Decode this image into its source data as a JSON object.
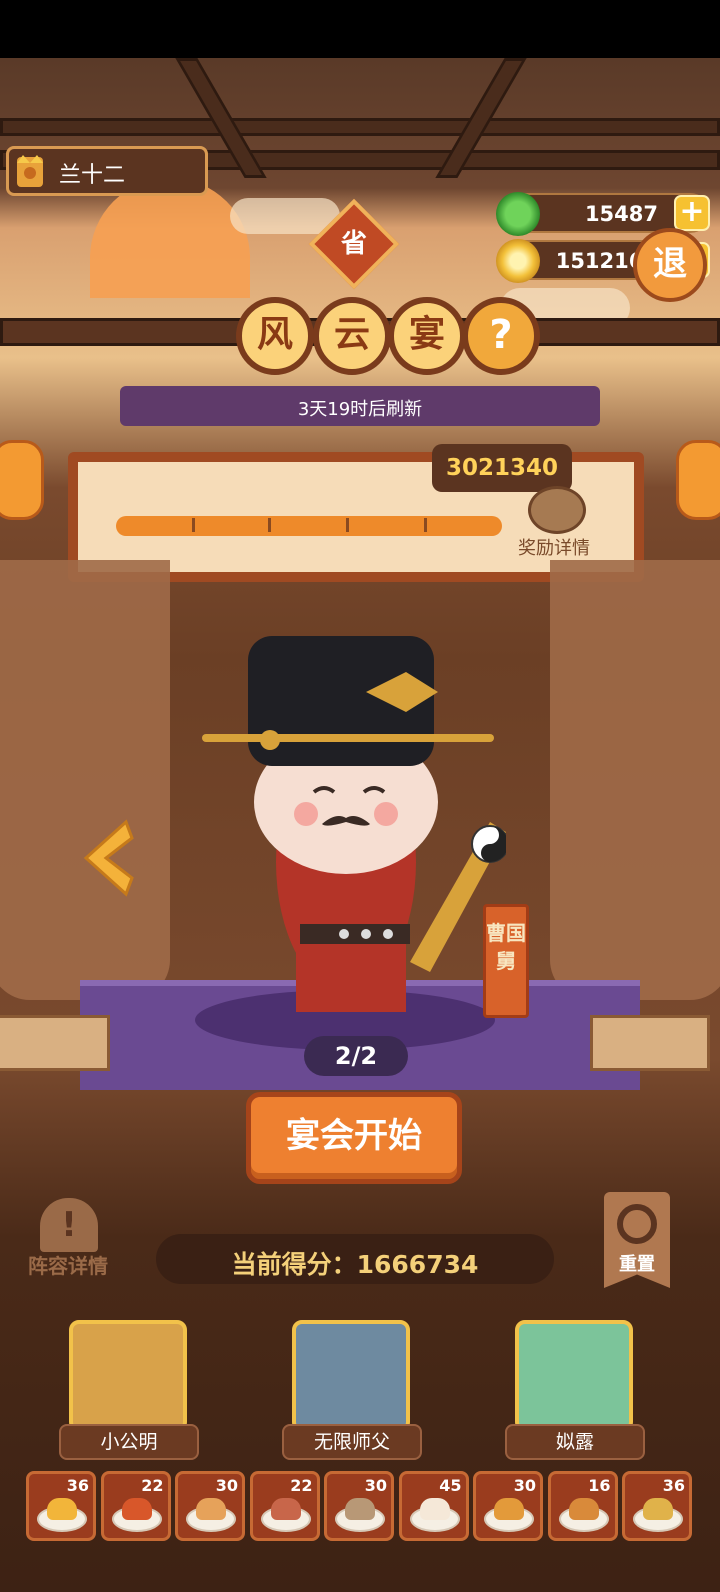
{
  "player": {
    "name": "兰十二"
  },
  "currency": {
    "jade": {
      "value": "15487",
      "icon": "jade-coin-icon"
    },
    "gold": {
      "value": "1512162",
      "icon": "gold-coin-icon"
    },
    "plus_label": "+"
  },
  "exit_label": "退",
  "province_badge": "省",
  "event_title": [
    "风",
    "云",
    "宴"
  ],
  "help_label": "?",
  "refresh_text": "3天19时后刷新",
  "progress": {
    "target_score": "3021340",
    "reward_label": "奖励详情",
    "fill_fraction": 1.0
  },
  "character": {
    "name": "曹国舅",
    "page": "2/2"
  },
  "start_button": "宴会开始",
  "lineup_label": "阵容详情",
  "reset_label": "重置",
  "current_score": {
    "label": "当前得分：",
    "value": "1666734"
  },
  "heroes": [
    {
      "name": "小公明",
      "color": "#d8a24a"
    },
    {
      "name": "无限师父",
      "color": "#6e8aa0"
    },
    {
      "name": "姒露",
      "color": "#7cc49a"
    }
  ],
  "dishes": [
    {
      "count": "36",
      "color": "#f2b53a"
    },
    {
      "count": "22",
      "color": "#d8572a"
    },
    {
      "count": "30",
      "color": "#e6a25a"
    },
    {
      "count": "22",
      "color": "#c8664a"
    },
    {
      "count": "30",
      "color": "#b89876"
    },
    {
      "count": "45",
      "color": "#f5e8d8"
    },
    {
      "count": "30",
      "color": "#e39a3a"
    },
    {
      "count": "16",
      "color": "#d98a3a"
    },
    {
      "count": "36",
      "color": "#e0b24a"
    }
  ]
}
